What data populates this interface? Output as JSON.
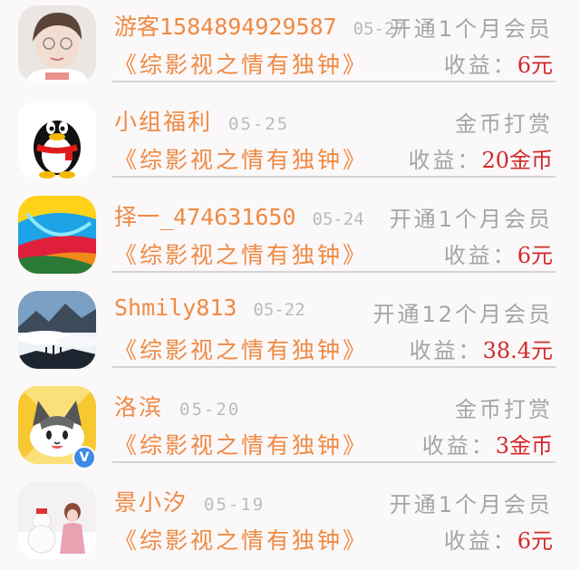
{
  "earnings_list": {
    "rows": [
      {
        "name": "游客1584894929587",
        "date": "05-27",
        "action": "开通1个月会员",
        "title": "《综影视之情有独钟》",
        "earn_label": "收益：",
        "earn_value": "6元",
        "avatar": "portrait-girl-avatar"
      },
      {
        "name": "小组福利",
        "date": "05-25",
        "action": "金币打赏",
        "title": "《综影视之情有独钟》",
        "earn_label": "收益：",
        "earn_value": "20金币",
        "avatar": "penguin-avatar"
      },
      {
        "name": "择一_474631650",
        "date": "05-24",
        "action": "开通1个月会员",
        "title": "《综影视之情有独钟》",
        "earn_label": "收益：",
        "earn_value": "6元",
        "avatar": "colorful-abstract-avatar"
      },
      {
        "name": "Shmily813",
        "date": "05-22",
        "action": "开通12个月会员",
        "title": "《综影视之情有独钟》",
        "earn_label": "收益：",
        "earn_value": "38.4元",
        "avatar": "mountain-landscape-avatar"
      },
      {
        "name": "洛滨",
        "date": "05-20",
        "action": "金币打赏",
        "title": "《综影视之情有独钟》",
        "earn_label": "收益：",
        "earn_value": "3金币",
        "avatar": "cartoon-cat-avatar",
        "verified_badge": "V"
      },
      {
        "name": "景小汐",
        "date": "05-19",
        "action": "开通1个月会员",
        "title": "《综影视之情有独钟》",
        "earn_label": "收益：",
        "earn_value": "6元",
        "avatar": "snowman-photo-avatar"
      }
    ]
  }
}
